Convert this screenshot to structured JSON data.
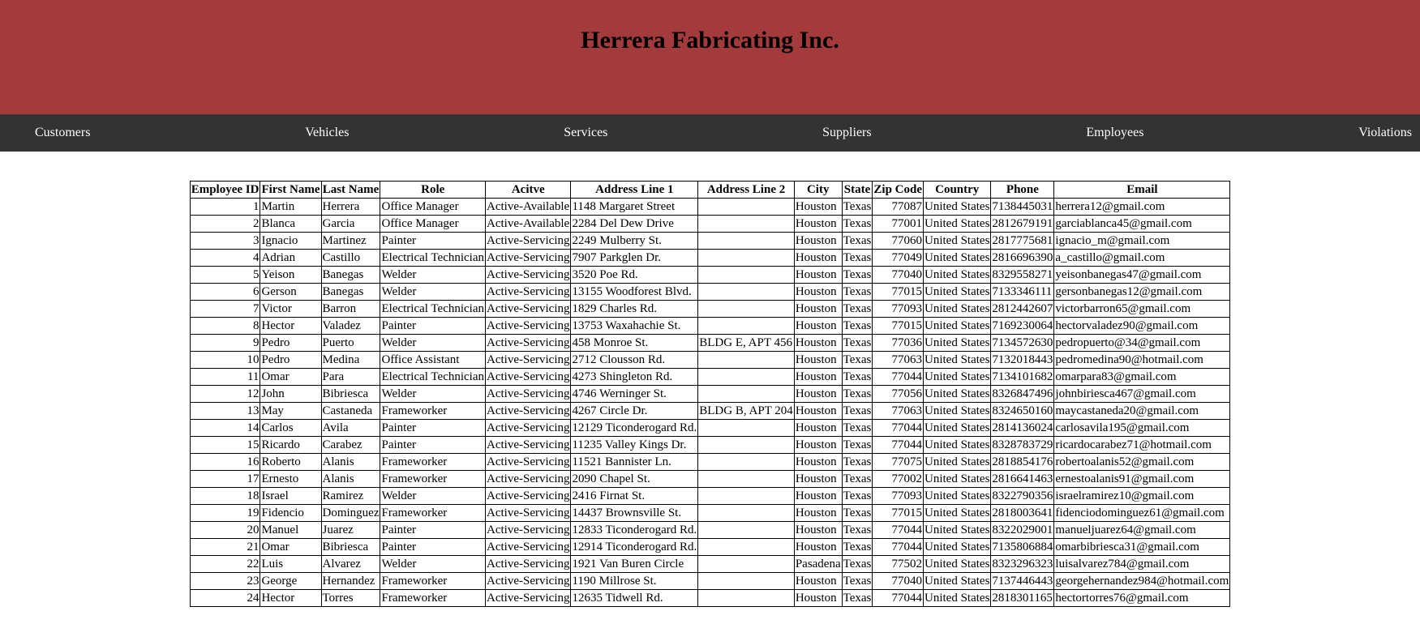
{
  "header": {
    "title": "Herrera Fabricating Inc."
  },
  "nav": {
    "items": [
      {
        "label": "Customers"
      },
      {
        "label": "Vehicles"
      },
      {
        "label": "Services"
      },
      {
        "label": "Suppliers"
      },
      {
        "label": "Employees"
      },
      {
        "label": "Violations"
      }
    ]
  },
  "table": {
    "headers": [
      "Employee ID",
      "First Name",
      "Last Name",
      "Role",
      "Acitve",
      "Address Line 1",
      "Address Line 2",
      "City",
      "State",
      "Zip Code",
      "Country",
      "Phone",
      "Email"
    ],
    "rows": [
      [
        "1",
        "Martin",
        "Herrera",
        "Office Manager",
        "Active-Available",
        "1148 Margaret Street",
        "",
        "Houston",
        "Texas",
        "77087",
        "United States",
        "7138445031",
        "herrera12@gmail.com"
      ],
      [
        "2",
        "Blanca",
        "Garcia",
        "Office Manager",
        "Active-Available",
        "2284 Del Dew Drive",
        "",
        "Houston",
        "Texas",
        "77001",
        "United States",
        "2812679191",
        "garciablanca45@gmail.com"
      ],
      [
        "3",
        "Ignacio",
        "Martinez",
        "Painter",
        "Active-Servicing",
        "2249 Mulberry St.",
        "",
        "Houston",
        "Texas",
        "77060",
        "United States",
        "2817775681",
        "ignacio_m@gmail.com"
      ],
      [
        "4",
        "Adrian",
        "Castillo",
        "Electrical Technician",
        "Active-Servicing",
        "7907 Parkglen Dr.",
        "",
        "Houston",
        "Texas",
        "77049",
        "United States",
        "2816696390",
        "a_castillo@gmail.com"
      ],
      [
        "5",
        "Yeison",
        "Banegas",
        "Welder",
        "Active-Servicing",
        "3520 Poe Rd.",
        "",
        "Houston",
        "Texas",
        "77040",
        "United States",
        "8329558271",
        "yeisonbanegas47@gmail.com"
      ],
      [
        "6",
        "Gerson",
        "Banegas",
        "Welder",
        "Active-Servicing",
        "13155 Woodforest Blvd.",
        "",
        "Houston",
        "Texas",
        "77015",
        "United States",
        "7133346111",
        "gersonbanegas12@gmail.com"
      ],
      [
        "7",
        "Victor",
        "Barron",
        "Electrical Technician",
        "Active-Servicing",
        "1829 Charles Rd.",
        "",
        "Houston",
        "Texas",
        "77093",
        "United States",
        "2812442607",
        "victorbarron65@gmail.com"
      ],
      [
        "8",
        "Hector",
        "Valadez",
        "Painter",
        "Active-Servicing",
        "13753 Waxahachie St.",
        "",
        "Houston",
        "Texas",
        "77015",
        "United States",
        "7169230064",
        "hectorvaladez90@gmail.com"
      ],
      [
        "9",
        "Pedro",
        "Puerto",
        "Welder",
        "Active-Servicing",
        "458 Monroe St.",
        "BLDG E, APT 456",
        "Houston",
        "Texas",
        "77036",
        "United States",
        "7134572630",
        "pedropuerto@34@gmail.com"
      ],
      [
        "10",
        "Pedro",
        "Medina",
        "Office Assistant",
        "Active-Servicing",
        "2712 Clousson Rd.",
        "",
        "Houston",
        "Texas",
        "77063",
        "United States",
        "7132018443",
        "pedromedina90@hotmail.com"
      ],
      [
        "11",
        "Omar",
        "Para",
        "Electrical Technician",
        "Active-Servicing",
        "4273 Shingleton Rd.",
        "",
        "Houston",
        "Texas",
        "77044",
        "United States",
        "7134101682",
        "omarpara83@gmail.com"
      ],
      [
        "12",
        "John",
        "Bibriesca",
        "Welder",
        "Active-Servicing",
        "4746 Werninger St.",
        "",
        "Houston",
        "Texas",
        "77056",
        "United States",
        "8326847496",
        "johnbiriesca467@gmail.com"
      ],
      [
        "13",
        "May",
        "Castaneda",
        "Frameworker",
        "Active-Servicing",
        "4267 Circle Dr.",
        "BLDG B, APT 204",
        "Houston",
        "Texas",
        "77063",
        "United States",
        "8324650160",
        "maycastaneda20@gmail.com"
      ],
      [
        "14",
        "Carlos",
        "Avila",
        "Painter",
        "Active-Servicing",
        "12129 Ticonderogard Rd.",
        "",
        "Houston",
        "Texas",
        "77044",
        "United States",
        "2814136024",
        "carlosavila195@gmail.com"
      ],
      [
        "15",
        "Ricardo",
        "Carabez",
        "Painter",
        "Active-Servicing",
        "11235 Valley Kings Dr.",
        "",
        "Houston",
        "Texas",
        "77044",
        "United States",
        "8328783729",
        "ricardocarabez71@hotmail.com"
      ],
      [
        "16",
        "Roberto",
        "Alanis",
        "Frameworker",
        "Active-Servicing",
        "11521 Bannister Ln.",
        "",
        "Houston",
        "Texas",
        "77075",
        "United States",
        "2818854176",
        "robertoalanis52@gmail.com"
      ],
      [
        "17",
        "Ernesto",
        "Alanis",
        "Frameworker",
        "Active-Servicing",
        "2090 Chapel St.",
        "",
        "Houston",
        "Texas",
        "77002",
        "United States",
        "2816641463",
        "ernestoalanis91@gmail.com"
      ],
      [
        "18",
        "Israel",
        "Ramirez",
        "Welder",
        "Active-Servicing",
        "2416 Firnat St.",
        "",
        "Houston",
        "Texas",
        "77093",
        "United States",
        "8322790356",
        "israelramirez10@gmail.com"
      ],
      [
        "19",
        "Fidencio",
        "Dominguez",
        "Frameworker",
        "Active-Servicing",
        "14437 Brownsville St.",
        "",
        "Houston",
        "Texas",
        "77015",
        "United States",
        "2818003641",
        "fidenciodominguez61@gmail.com"
      ],
      [
        "20",
        "Manuel",
        "Juarez",
        "Painter",
        "Active-Servicing",
        "12833 Ticonderogard Rd.",
        "",
        "Houston",
        "Texas",
        "77044",
        "United States",
        "8322029001",
        "manueljuarez64@gmail.com"
      ],
      [
        "21",
        "Omar",
        "Bibriesca",
        "Painter",
        "Active-Servicing",
        "12914 Ticonderogard Rd.",
        "",
        "Houston",
        "Texas",
        "77044",
        "United States",
        "7135806884",
        "omarbibriesca31@gmail.com"
      ],
      [
        "22",
        "Luis",
        "Alvarez",
        "Welder",
        "Active-Servicing",
        "1921 Van Buren Circle",
        "",
        "Pasadena",
        "Texas",
        "77502",
        "United States",
        "8323296323",
        "luisalvarez784@gmail.com"
      ],
      [
        "23",
        "George",
        "Hernandez",
        "Frameworker",
        "Active-Servicing",
        "1190 Millrose St.",
        "",
        "Houston",
        "Texas",
        "77040",
        "United States",
        "7137446443",
        "georgehernandez984@hotmail.com"
      ],
      [
        "24",
        "Hector",
        "Torres",
        "Frameworker",
        "Active-Servicing",
        "12635 Tidwell Rd.",
        "",
        "Houston",
        "Texas",
        "77044",
        "United States",
        "2818301165",
        "hectortorres76@gmail.com"
      ]
    ]
  }
}
